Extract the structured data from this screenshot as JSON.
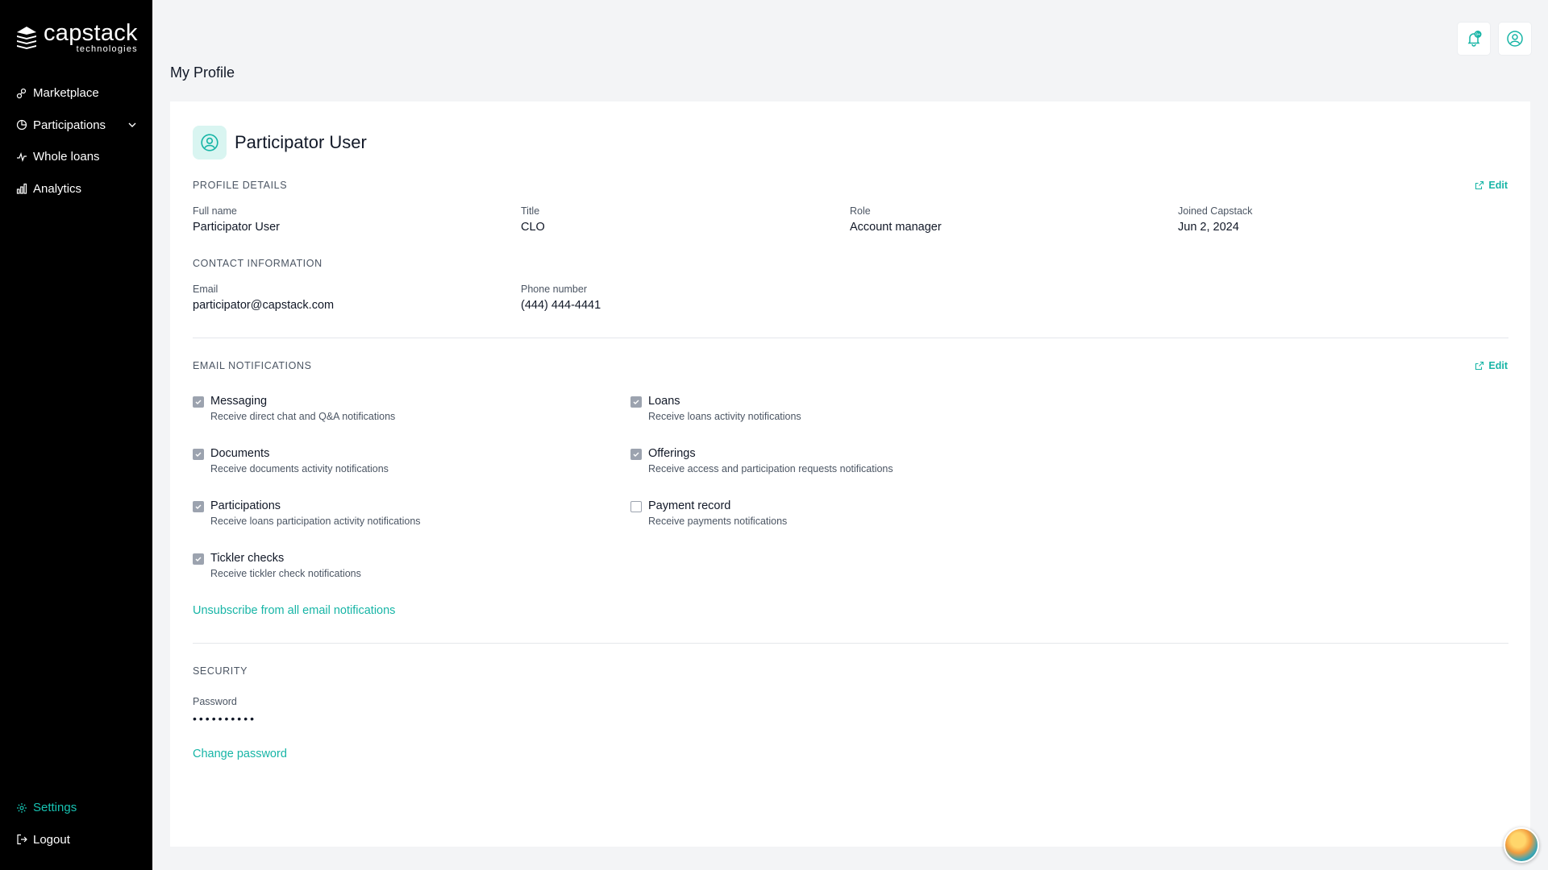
{
  "brand": {
    "name": "capstack",
    "sub": "technologies"
  },
  "nav": {
    "items": [
      {
        "label": "Marketplace",
        "icon": "marketplace-icon"
      },
      {
        "label": "Participations",
        "icon": "participations-icon"
      },
      {
        "label": "Whole loans",
        "icon": "whole-loans-icon"
      },
      {
        "label": "Analytics",
        "icon": "analytics-icon"
      }
    ],
    "bottom": [
      {
        "label": "Settings",
        "icon": "gear-icon",
        "active": true
      },
      {
        "label": "Logout",
        "icon": "logout-icon"
      }
    ]
  },
  "topbar": {
    "notification_badge": "9+"
  },
  "page": {
    "title": "My Profile"
  },
  "profile": {
    "name": "Participator User",
    "details_label": "PROFILE DETAILS",
    "edit_label": "Edit",
    "fields": [
      {
        "label": "Full name",
        "value": "Participator User"
      },
      {
        "label": "Title",
        "value": "CLO"
      },
      {
        "label": "Role",
        "value": "Account manager"
      },
      {
        "label": "Joined Capstack",
        "value": "Jun 2, 2024"
      }
    ],
    "contact_label": "CONTACT INFORMATION",
    "contact": [
      {
        "label": "Email",
        "value": "participator@capstack.com"
      },
      {
        "label": "Phone number",
        "value": "(444) 444-4441"
      }
    ]
  },
  "notifications": {
    "label": "EMAIL NOTIFICATIONS",
    "edit_label": "Edit",
    "items": [
      {
        "title": "Messaging",
        "desc": "Receive direct chat and Q&A notifications",
        "checked": true
      },
      {
        "title": "Loans",
        "desc": "Receive loans activity notifications",
        "checked": true
      },
      {
        "title": "Documents",
        "desc": "Receive documents activity notifications",
        "checked": true
      },
      {
        "title": "Offerings",
        "desc": "Receive access and participation requests notifications",
        "checked": true
      },
      {
        "title": "Participations",
        "desc": "Receive loans participation activity notifications",
        "checked": true
      },
      {
        "title": "Payment record",
        "desc": "Receive payments notifications",
        "checked": false
      },
      {
        "title": "Tickler checks",
        "desc": "Receive tickler check notifications",
        "checked": true
      }
    ],
    "unsubscribe_label": "Unsubscribe from all email notifications"
  },
  "security": {
    "label": "SECURITY",
    "password_label": "Password",
    "password_mask": "••••••••••",
    "change_label": "Change password"
  },
  "colors": {
    "accent": "#17b5a6",
    "sidebar": "#000000",
    "background": "#f3f4f6"
  }
}
